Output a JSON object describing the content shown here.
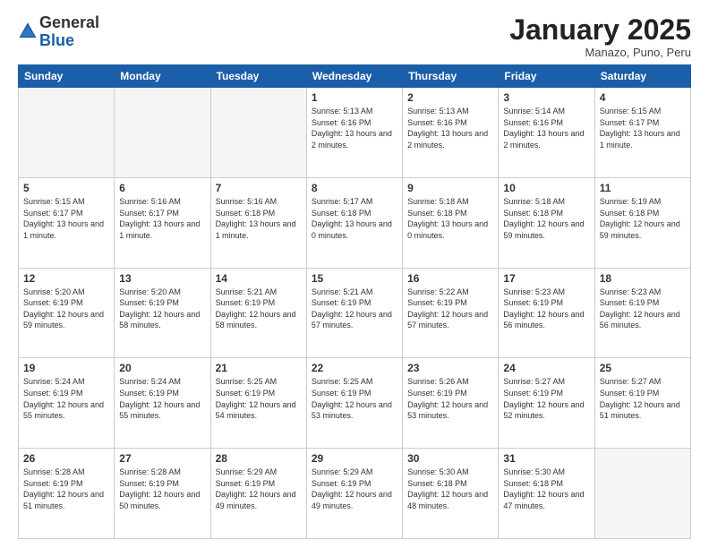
{
  "logo": {
    "general": "General",
    "blue": "Blue"
  },
  "header": {
    "month": "January 2025",
    "location": "Manazo, Puno, Peru"
  },
  "weekdays": [
    "Sunday",
    "Monday",
    "Tuesday",
    "Wednesday",
    "Thursday",
    "Friday",
    "Saturday"
  ],
  "weeks": [
    [
      {
        "day": "",
        "empty": true
      },
      {
        "day": "",
        "empty": true
      },
      {
        "day": "",
        "empty": true
      },
      {
        "day": "1",
        "sunrise": "5:13 AM",
        "sunset": "6:16 PM",
        "daylight": "13 hours and 2 minutes."
      },
      {
        "day": "2",
        "sunrise": "5:13 AM",
        "sunset": "6:16 PM",
        "daylight": "13 hours and 2 minutes."
      },
      {
        "day": "3",
        "sunrise": "5:14 AM",
        "sunset": "6:16 PM",
        "daylight": "13 hours and 2 minutes."
      },
      {
        "day": "4",
        "sunrise": "5:15 AM",
        "sunset": "6:17 PM",
        "daylight": "13 hours and 1 minute."
      }
    ],
    [
      {
        "day": "5",
        "sunrise": "5:15 AM",
        "sunset": "6:17 PM",
        "daylight": "13 hours and 1 minute."
      },
      {
        "day": "6",
        "sunrise": "5:16 AM",
        "sunset": "6:17 PM",
        "daylight": "13 hours and 1 minute."
      },
      {
        "day": "7",
        "sunrise": "5:16 AM",
        "sunset": "6:18 PM",
        "daylight": "13 hours and 1 minute."
      },
      {
        "day": "8",
        "sunrise": "5:17 AM",
        "sunset": "6:18 PM",
        "daylight": "13 hours and 0 minutes."
      },
      {
        "day": "9",
        "sunrise": "5:18 AM",
        "sunset": "6:18 PM",
        "daylight": "13 hours and 0 minutes."
      },
      {
        "day": "10",
        "sunrise": "5:18 AM",
        "sunset": "6:18 PM",
        "daylight": "12 hours and 59 minutes."
      },
      {
        "day": "11",
        "sunrise": "5:19 AM",
        "sunset": "6:18 PM",
        "daylight": "12 hours and 59 minutes."
      }
    ],
    [
      {
        "day": "12",
        "sunrise": "5:20 AM",
        "sunset": "6:19 PM",
        "daylight": "12 hours and 59 minutes."
      },
      {
        "day": "13",
        "sunrise": "5:20 AM",
        "sunset": "6:19 PM",
        "daylight": "12 hours and 58 minutes."
      },
      {
        "day": "14",
        "sunrise": "5:21 AM",
        "sunset": "6:19 PM",
        "daylight": "12 hours and 58 minutes."
      },
      {
        "day": "15",
        "sunrise": "5:21 AM",
        "sunset": "6:19 PM",
        "daylight": "12 hours and 57 minutes."
      },
      {
        "day": "16",
        "sunrise": "5:22 AM",
        "sunset": "6:19 PM",
        "daylight": "12 hours and 57 minutes."
      },
      {
        "day": "17",
        "sunrise": "5:23 AM",
        "sunset": "6:19 PM",
        "daylight": "12 hours and 56 minutes."
      },
      {
        "day": "18",
        "sunrise": "5:23 AM",
        "sunset": "6:19 PM",
        "daylight": "12 hours and 56 minutes."
      }
    ],
    [
      {
        "day": "19",
        "sunrise": "5:24 AM",
        "sunset": "6:19 PM",
        "daylight": "12 hours and 55 minutes."
      },
      {
        "day": "20",
        "sunrise": "5:24 AM",
        "sunset": "6:19 PM",
        "daylight": "12 hours and 55 minutes."
      },
      {
        "day": "21",
        "sunrise": "5:25 AM",
        "sunset": "6:19 PM",
        "daylight": "12 hours and 54 minutes."
      },
      {
        "day": "22",
        "sunrise": "5:25 AM",
        "sunset": "6:19 PM",
        "daylight": "12 hours and 53 minutes."
      },
      {
        "day": "23",
        "sunrise": "5:26 AM",
        "sunset": "6:19 PM",
        "daylight": "12 hours and 53 minutes."
      },
      {
        "day": "24",
        "sunrise": "5:27 AM",
        "sunset": "6:19 PM",
        "daylight": "12 hours and 52 minutes."
      },
      {
        "day": "25",
        "sunrise": "5:27 AM",
        "sunset": "6:19 PM",
        "daylight": "12 hours and 51 minutes."
      }
    ],
    [
      {
        "day": "26",
        "sunrise": "5:28 AM",
        "sunset": "6:19 PM",
        "daylight": "12 hours and 51 minutes."
      },
      {
        "day": "27",
        "sunrise": "5:28 AM",
        "sunset": "6:19 PM",
        "daylight": "12 hours and 50 minutes."
      },
      {
        "day": "28",
        "sunrise": "5:29 AM",
        "sunset": "6:19 PM",
        "daylight": "12 hours and 49 minutes."
      },
      {
        "day": "29",
        "sunrise": "5:29 AM",
        "sunset": "6:19 PM",
        "daylight": "12 hours and 49 minutes."
      },
      {
        "day": "30",
        "sunrise": "5:30 AM",
        "sunset": "6:18 PM",
        "daylight": "12 hours and 48 minutes."
      },
      {
        "day": "31",
        "sunrise": "5:30 AM",
        "sunset": "6:18 PM",
        "daylight": "12 hours and 47 minutes."
      },
      {
        "day": "",
        "empty": true
      }
    ]
  ]
}
